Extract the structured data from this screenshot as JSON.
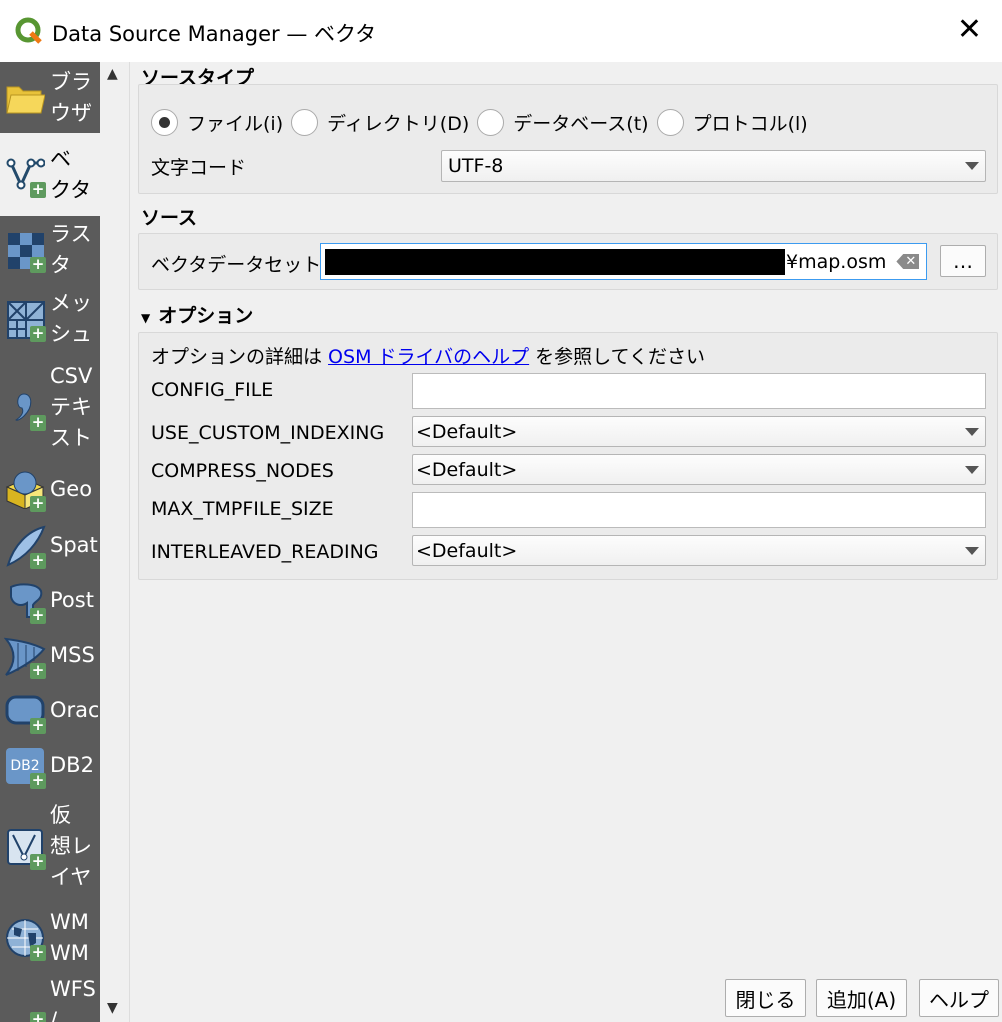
{
  "window": {
    "title": "Data Source Manager — ベクタ"
  },
  "sidebar": {
    "items": [
      {
        "label": "ブラ\nウザ",
        "icon": "folder-icon"
      },
      {
        "label": "ベ\nクタ",
        "icon": "vector-icon"
      },
      {
        "label": "ラス\nタ",
        "icon": "raster-icon"
      },
      {
        "label": "メッ\nシュ",
        "icon": "mesh-icon"
      },
      {
        "label": "CSV\nテキ\nスト",
        "icon": "csv-icon"
      },
      {
        "label": "Geo",
        "icon": "geopackage-icon"
      },
      {
        "label": "Spat",
        "icon": "spatialite-icon"
      },
      {
        "label": "Post",
        "icon": "postgis-icon"
      },
      {
        "label": "MSS",
        "icon": "mssql-icon"
      },
      {
        "label": "Orac",
        "icon": "oracle-icon"
      },
      {
        "label": "DB2",
        "icon": "db2-icon",
        "icon_text": "DB2"
      },
      {
        "label": "仮\n想レ\nイヤ",
        "icon": "virtual-layer-icon"
      },
      {
        "label": "WM\nWM",
        "icon": "wms-icon"
      },
      {
        "label": "WFS\n/",
        "icon": "wfs-icon"
      }
    ]
  },
  "source_type": {
    "heading": "ソースタイプ",
    "radios": [
      {
        "label": "ファイル(i)",
        "checked": true
      },
      {
        "label": "ディレクトリ(D)",
        "checked": false
      },
      {
        "label": "データベース(t)",
        "checked": false
      },
      {
        "label": "プロトコル(l)",
        "checked": false
      }
    ],
    "encoding_label": "文字コード",
    "encoding_value": "UTF-8"
  },
  "source": {
    "heading": "ソース",
    "dataset_label": "ベクタデータセット",
    "dataset_value_visible": "¥map.osm",
    "browse_label": "…"
  },
  "options": {
    "heading": "オプション",
    "help_prefix": "オプションの詳細は ",
    "help_link": "OSM ドライバのヘルプ",
    "help_suffix": " を参照してください",
    "rows": [
      {
        "label": "CONFIG_FILE",
        "type": "text",
        "value": ""
      },
      {
        "label": "USE_CUSTOM_INDEXING",
        "type": "combo",
        "value": "<Default>"
      },
      {
        "label": "COMPRESS_NODES",
        "type": "combo",
        "value": "<Default>"
      },
      {
        "label": "MAX_TMPFILE_SIZE",
        "type": "text",
        "value": ""
      },
      {
        "label": "INTERLEAVED_READING",
        "type": "combo",
        "value": "<Default>"
      }
    ]
  },
  "buttons": {
    "close": "閉じる",
    "add": "追加(A)",
    "help": "ヘルプ"
  }
}
